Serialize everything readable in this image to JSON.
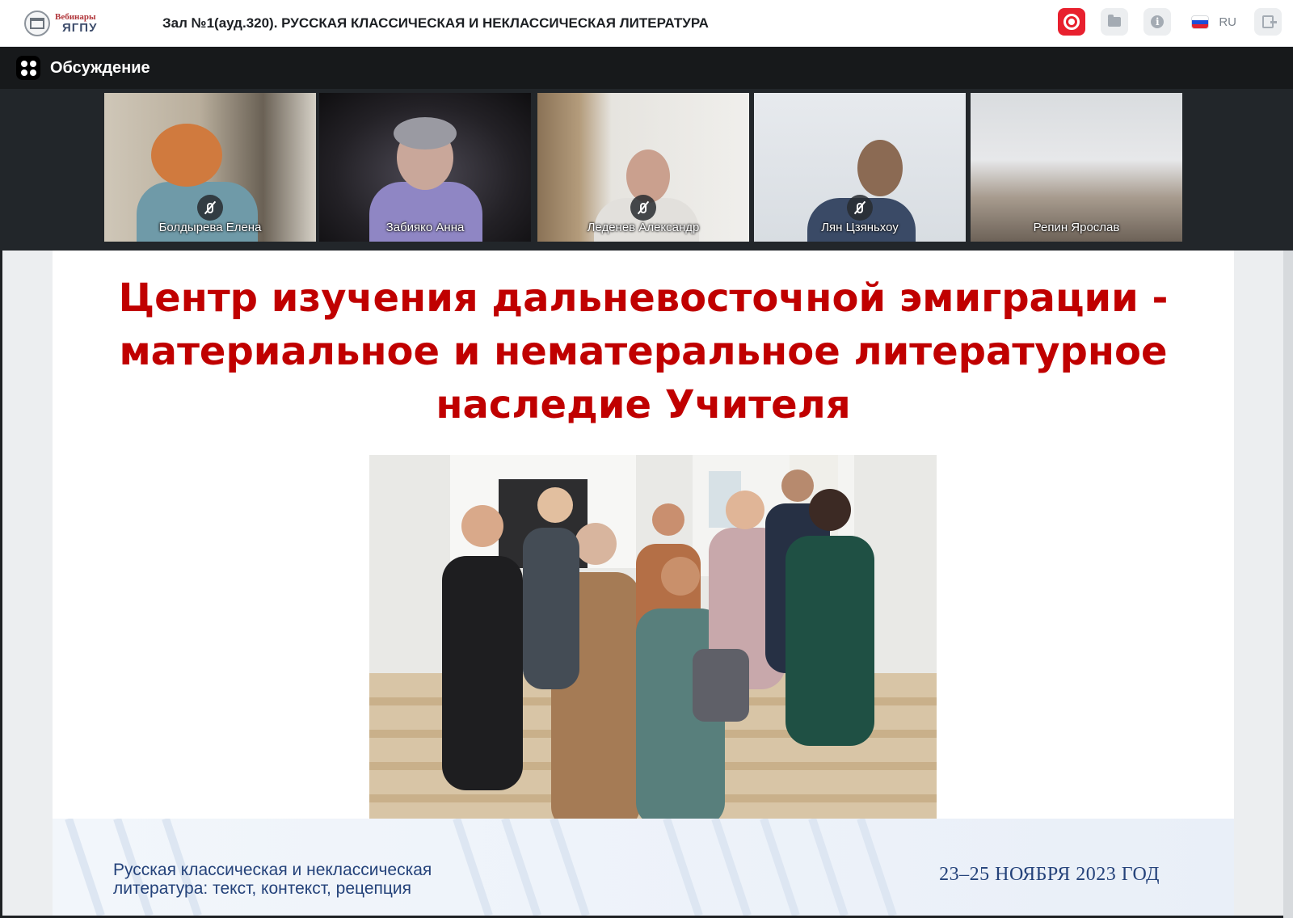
{
  "header": {
    "logo_top": "Вебинары",
    "logo_bottom": "ЯГПУ",
    "room_title": "Зал №1(ауд.320). РУССКАЯ КЛАССИЧЕСКАЯ И НЕКЛАССИЧЕСКАЯ ЛИТЕРАТУРА",
    "language": "RU",
    "record_color": "#e8202e",
    "icons": [
      "record-icon",
      "folder-icon",
      "info-icon",
      "flag-ru-icon",
      "exit-icon"
    ]
  },
  "discussion": {
    "title": "Обсуждение"
  },
  "participants": [
    {
      "name": "Болдырева Елена",
      "muted": true
    },
    {
      "name": "Забияко Анна",
      "muted": false
    },
    {
      "name": "Леденев Александр",
      "muted": true
    },
    {
      "name": "Лян Цзяньхоу",
      "muted": true
    },
    {
      "name": "Репин Ярослав",
      "muted": false
    }
  ],
  "slide": {
    "title_line1": "Центр изучения дальневосточной эмиграции -",
    "title_line2": "материальное и нематеральное литературное",
    "title_line3": "наследие Учителя",
    "footer_left_line1": "Русская классическая и неклассическая",
    "footer_left_line2": "литература: текст, контекст, рецепция",
    "footer_right": "23–25 НОЯБРЯ 2023 ГОД",
    "title_color": "#c00000",
    "footer_color": "#24427a"
  }
}
